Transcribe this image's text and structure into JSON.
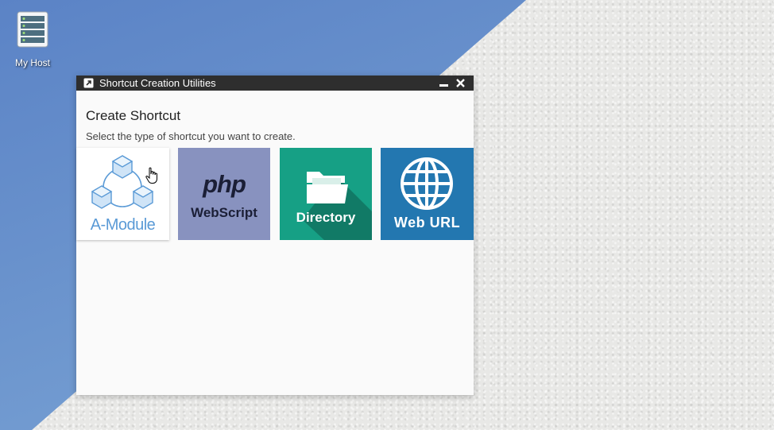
{
  "desktop": {
    "icon": {
      "label": "My Host",
      "icon_name": "server-icon"
    },
    "wallpaper_colors": {
      "blue": "#6f98cf",
      "stone": "#e8e8e6"
    }
  },
  "window": {
    "title": "Shortcut Creation Utilities",
    "title_icon": "shortcut-arrow-icon",
    "controls": {
      "minimize_icon": "minimize-icon",
      "close_icon": "close-icon"
    },
    "heading": "Create Shortcut",
    "subtitle": "Select the type of shortcut you want to create.",
    "tiles": [
      {
        "id": "amodule",
        "label": "A-Module",
        "icon": "modules-icon",
        "color": "#ffffff",
        "text_color": "#5a9ad6"
      },
      {
        "id": "php",
        "logo_text": "php",
        "label": "WebScript",
        "icon": "php-logo-icon",
        "color": "#8892bf",
        "text_color": "#1b1f36"
      },
      {
        "id": "dir",
        "label": "Directory",
        "icon": "folder-icon",
        "color": "#16a085",
        "text_color": "#ffffff"
      },
      {
        "id": "web",
        "label": "Web URL",
        "icon": "globe-icon",
        "color": "#2377b0",
        "text_color": "#ffffff"
      }
    ]
  },
  "colors": {
    "titlebar": "#2e2e2e",
    "window_bg": "#fafafa"
  }
}
